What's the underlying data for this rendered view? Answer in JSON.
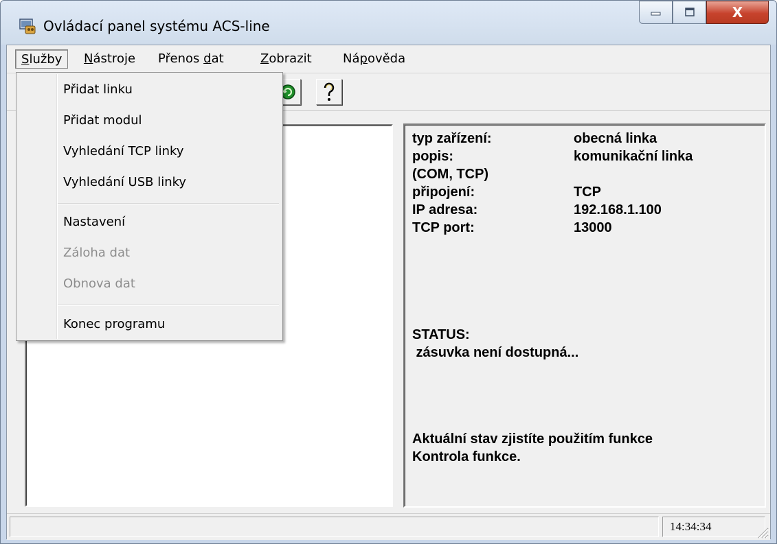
{
  "window": {
    "title": "Ovládací panel systému ACS-line",
    "close_symbol": "X",
    "icons": [
      "app-icon",
      "minimize-icon",
      "maximize-icon",
      "close-icon"
    ]
  },
  "menubar": {
    "items": [
      {
        "label": "Služby",
        "accel": "S",
        "rest": "lužby"
      },
      {
        "label": "Nástroje",
        "accel": "N",
        "rest": "ástroje"
      },
      {
        "label": "Přenos dat",
        "pre": "Přenos ",
        "accel": "d",
        "rest": "at"
      },
      {
        "label": "Zobrazit",
        "accel": "Z",
        "rest": "obrazit"
      },
      {
        "label": "Nápověda",
        "pre": "Ná",
        "accel": "p",
        "rest": "ověda"
      }
    ]
  },
  "toolbar": {
    "icons": [
      "refresh-icon",
      "help-icon"
    ]
  },
  "dropdown": {
    "items": [
      {
        "label": "Přidat linku",
        "enabled": true
      },
      {
        "label": "Přidat modul",
        "enabled": true
      },
      {
        "label": "Vyhledání TCP linky",
        "enabled": true
      },
      {
        "label": "Vyhledání USB linky",
        "enabled": true
      },
      {
        "label": "Nastavení",
        "enabled": true
      },
      {
        "label": "Záloha dat",
        "enabled": false
      },
      {
        "label": "Obnova dat",
        "enabled": false
      },
      {
        "label": "Konec programu",
        "enabled": true
      }
    ]
  },
  "details": {
    "device_type_label": "typ zařízení:",
    "device_type_value": "obecná linka",
    "description_label": "popis:",
    "description_value": "komunikační linka",
    "description_cont": "(COM, TCP)",
    "connection_label": "připojení:",
    "connection_value": "TCP",
    "ip_label": "IP adresa:",
    "ip_value": "192.168.1.100",
    "port_label": "TCP port:",
    "port_value": "13000",
    "status_label": "STATUS:",
    "status_value": " zásuvka není dostupná...",
    "hint_line1": "Aktuální stav zjistíte použitím funkce",
    "hint_line2": "Kontrola funkce."
  },
  "statusbar": {
    "time": "14:34:34"
  },
  "colors": {
    "close_button": "#c7432d",
    "face": "#f0f0f0"
  }
}
